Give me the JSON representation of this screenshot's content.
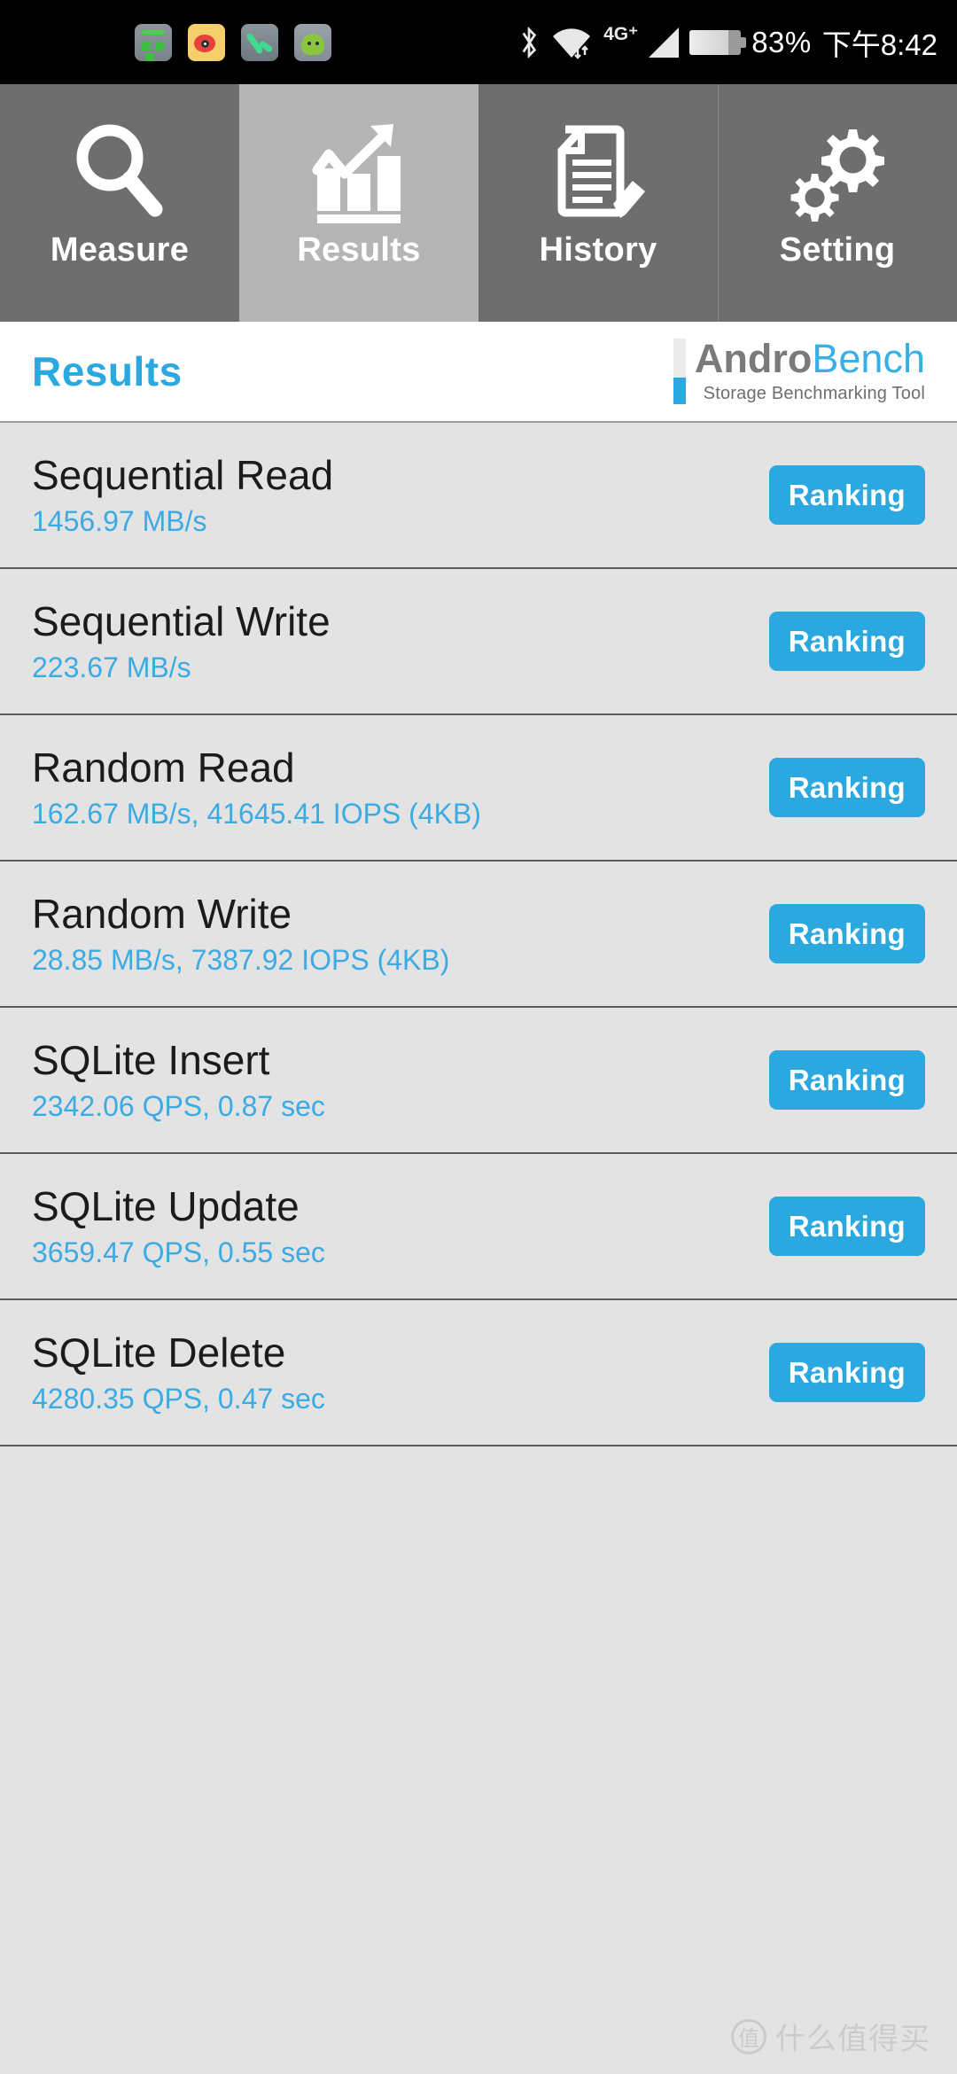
{
  "statusbar": {
    "notification_icons": [
      "file-manager-icon",
      "weibo-icon",
      "phone-icon",
      "android-icon"
    ],
    "bluetooth_icon": "bluetooth-icon",
    "wifi_icon": "wifi-icon",
    "network_type": "4G⁺",
    "signal_icon": "cellular-signal-icon",
    "battery_icon": "battery-icon",
    "battery_percent": "83%",
    "time": "下午8:42"
  },
  "tabs": [
    {
      "label": "Measure",
      "icon": "magnifier-icon",
      "active": false
    },
    {
      "label": "Results",
      "icon": "bar-chart-arrow-icon",
      "active": true
    },
    {
      "label": "History",
      "icon": "document-pencil-icon",
      "active": false
    },
    {
      "label": "Setting",
      "icon": "gears-icon",
      "active": false
    }
  ],
  "header": {
    "page_title": "Results",
    "brand_primary": "Andro",
    "brand_secondary": "Bench",
    "brand_subtitle": "Storage Benchmarking Tool"
  },
  "results": [
    {
      "name": "Sequential Read",
      "value": "1456.97 MB/s",
      "button": "Ranking"
    },
    {
      "name": "Sequential Write",
      "value": "223.67 MB/s",
      "button": "Ranking"
    },
    {
      "name": "Random Read",
      "value": "162.67 MB/s, 41645.41 IOPS (4KB)",
      "button": "Ranking"
    },
    {
      "name": "Random Write",
      "value": "28.85 MB/s, 7387.92 IOPS (4KB)",
      "button": "Ranking"
    },
    {
      "name": "SQLite Insert",
      "value": "2342.06 QPS, 0.87 sec",
      "button": "Ranking"
    },
    {
      "name": "SQLite Update",
      "value": "3659.47 QPS, 0.55 sec",
      "button": "Ranking"
    },
    {
      "name": "SQLite Delete",
      "value": "4280.35 QPS, 0.47 sec",
      "button": "Ranking"
    }
  ],
  "watermark": {
    "badge": "值",
    "text": "什么值得买"
  },
  "colors": {
    "accent_blue": "#2ba8e0",
    "value_blue": "#3cabe4",
    "row_bg": "#e3e3e3",
    "tab_inactive": "#6e6e6e",
    "tab_active": "#b5b5b5",
    "statusbar_bg": "#000000"
  }
}
